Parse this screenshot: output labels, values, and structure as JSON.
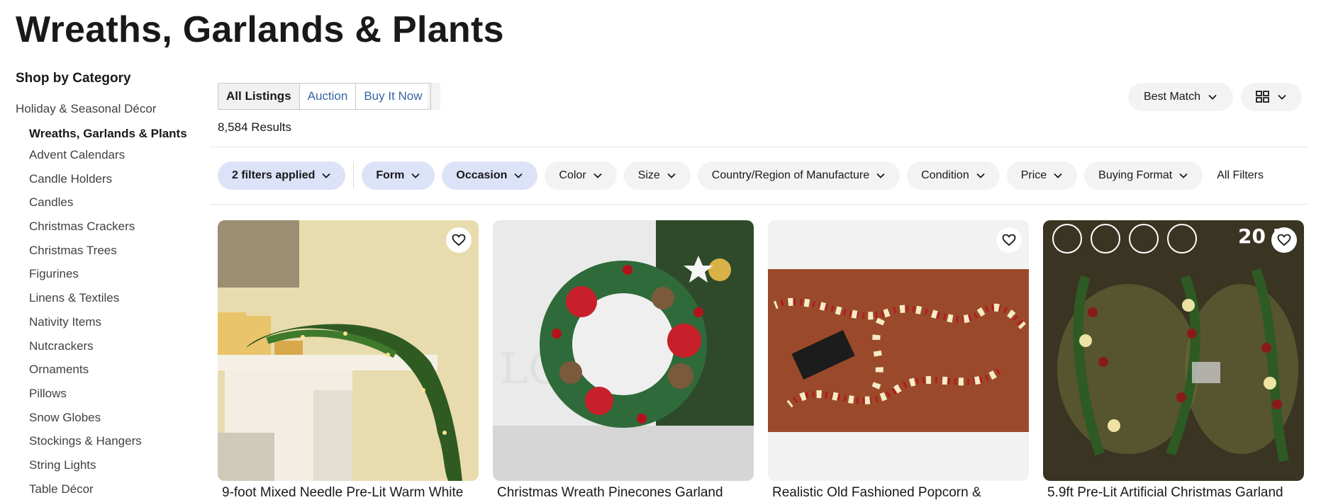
{
  "page": {
    "title": "Wreaths, Garlands & Plants"
  },
  "sidebar": {
    "heading": "Shop by Category",
    "parent": "Holiday & Seasonal Décor",
    "items": [
      {
        "label": "Wreaths, Garlands & Plants",
        "current": true
      },
      {
        "label": "Advent Calendars"
      },
      {
        "label": "Candle Holders"
      },
      {
        "label": "Candles"
      },
      {
        "label": "Christmas Crackers"
      },
      {
        "label": "Christmas Trees"
      },
      {
        "label": "Figurines"
      },
      {
        "label": "Linens & Textiles"
      },
      {
        "label": "Nativity Items"
      },
      {
        "label": "Nutcrackers"
      },
      {
        "label": "Ornaments"
      },
      {
        "label": "Pillows"
      },
      {
        "label": "Snow Globes"
      },
      {
        "label": "Stockings & Hangers"
      },
      {
        "label": "String Lights"
      },
      {
        "label": "Table Décor"
      }
    ]
  },
  "tabs": [
    "All Listings",
    "Auction",
    "Buy It Now"
  ],
  "results": "8,584 Results",
  "sort": {
    "label": "Best Match",
    "icon": "chevron-down-icon"
  },
  "view": {
    "icon": "grid-view-icon"
  },
  "filters": {
    "pills": [
      {
        "label": "2 filters applied",
        "active": true
      },
      {
        "label": "Form",
        "active": true
      },
      {
        "label": "Occasion",
        "active": true
      },
      {
        "label": "Color"
      },
      {
        "label": "Size"
      },
      {
        "label": "Country/Region of Manufacture"
      },
      {
        "label": "Condition"
      },
      {
        "label": "Price"
      },
      {
        "label": "Buying Format"
      }
    ],
    "all_filters": "All Filters"
  },
  "products": [
    {
      "title": "9-foot Mixed Needle Pre-Lit Warm White",
      "watch_icon": "heart-icon"
    },
    {
      "title": "Christmas Wreath Pinecones Garland"
    },
    {
      "title": "Realistic Old Fashioned Popcorn &",
      "watch_icon": "heart-icon"
    },
    {
      "title": "5.9ft Pre-Lit Artificial Christmas Garland",
      "watch_icon": "heart-icon",
      "badge_text": "20 L"
    }
  ],
  "colors": {
    "active_pill": "#dce3f8",
    "pill": "#f3f3f3",
    "link": "#3665a4"
  }
}
